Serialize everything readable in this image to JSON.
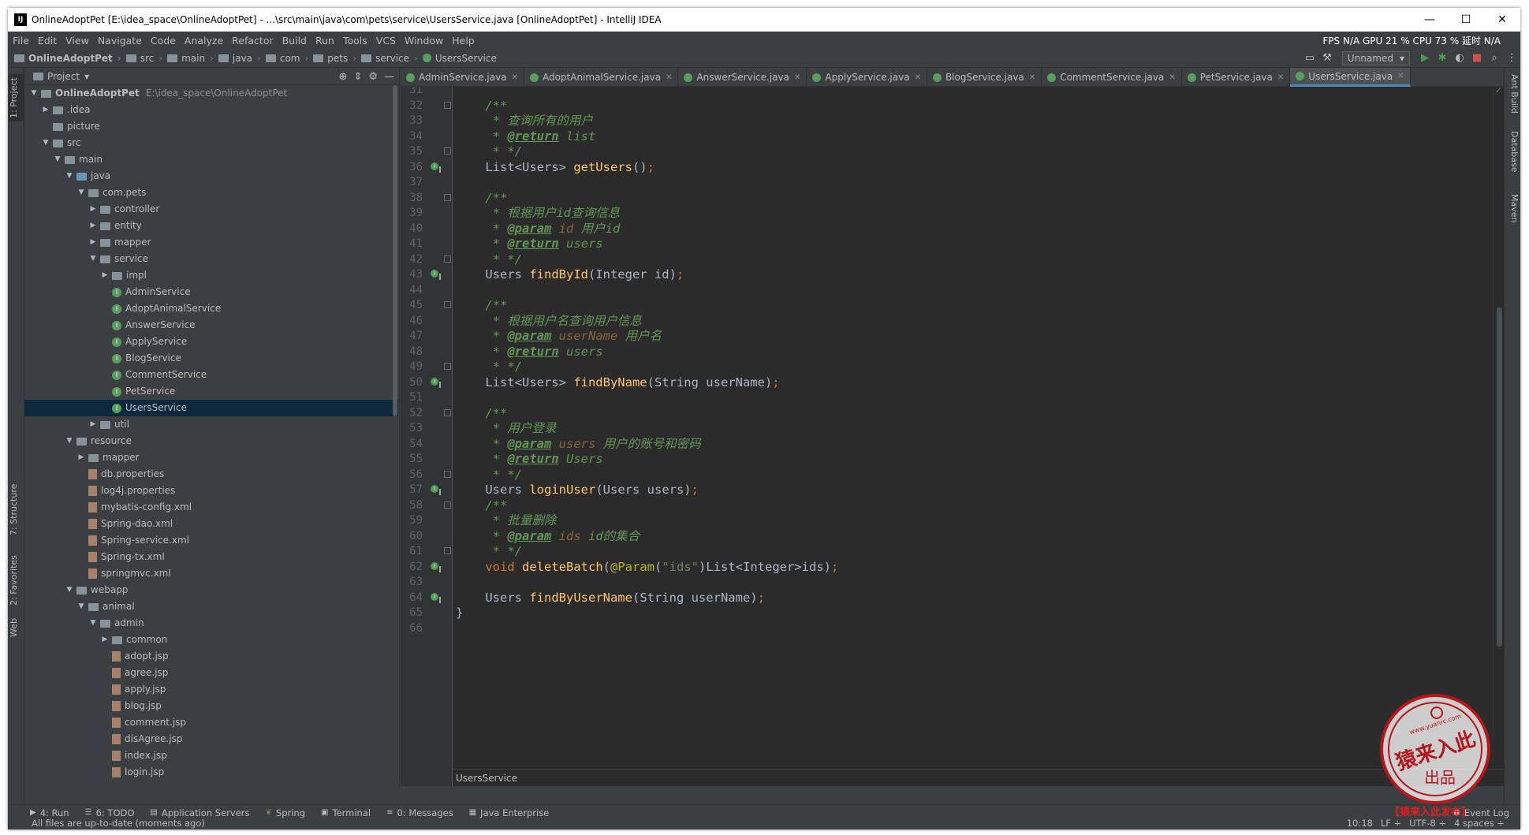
{
  "window": {
    "title": "OnlineAdoptPet [E:\\idea_space\\OnlineAdoptPet] - ...\\src\\main\\java\\com\\pets\\service\\UsersService.java [OnlineAdoptPet] - IntelliJ IDEA",
    "app_badge": "IJ",
    "minimize": "—",
    "maximize": "☐",
    "close": "✕"
  },
  "menu": [
    "File",
    "Edit",
    "View",
    "Navigate",
    "Code",
    "Analyze",
    "Refactor",
    "Build",
    "Run",
    "Tools",
    "VCS",
    "Window",
    "Help"
  ],
  "perf": "FPS  N/A  GPU  21 %  CPU  73 %  延时  N/A",
  "breadcrumb": [
    "OnlineAdoptPet",
    "src",
    "main",
    "java",
    "com",
    "pets",
    "service",
    "UsersService"
  ],
  "run_config": "Unnamed",
  "project_panel": {
    "title": "Project"
  },
  "tree": [
    {
      "label": "OnlineAdoptPet",
      "path": "E:\\idea_space\\OnlineAdoptPet",
      "depth": 0,
      "kind": "module",
      "open": true
    },
    {
      "label": ".idea",
      "depth": 1,
      "kind": "folder",
      "open": false
    },
    {
      "label": "picture",
      "depth": 1,
      "kind": "folder",
      "leaf": true
    },
    {
      "label": "src",
      "depth": 1,
      "kind": "folder",
      "open": true
    },
    {
      "label": "main",
      "depth": 2,
      "kind": "folder",
      "open": true
    },
    {
      "label": "java",
      "depth": 3,
      "kind": "src",
      "open": true
    },
    {
      "label": "com.pets",
      "depth": 4,
      "kind": "folder",
      "open": true
    },
    {
      "label": "controller",
      "depth": 5,
      "kind": "folder",
      "open": false
    },
    {
      "label": "entity",
      "depth": 5,
      "kind": "folder",
      "open": false
    },
    {
      "label": "mapper",
      "depth": 5,
      "kind": "folder",
      "open": false
    },
    {
      "label": "service",
      "depth": 5,
      "kind": "folder",
      "open": true
    },
    {
      "label": "impl",
      "depth": 6,
      "kind": "folder",
      "open": false
    },
    {
      "label": "AdminService",
      "depth": 6,
      "kind": "interface"
    },
    {
      "label": "AdoptAnimalService",
      "depth": 6,
      "kind": "interface"
    },
    {
      "label": "AnswerService",
      "depth": 6,
      "kind": "interface"
    },
    {
      "label": "ApplyService",
      "depth": 6,
      "kind": "interface"
    },
    {
      "label": "BlogService",
      "depth": 6,
      "kind": "interface"
    },
    {
      "label": "CommentService",
      "depth": 6,
      "kind": "interface"
    },
    {
      "label": "PetService",
      "depth": 6,
      "kind": "interface"
    },
    {
      "label": "UsersService",
      "depth": 6,
      "kind": "interface",
      "selected": true
    },
    {
      "label": "util",
      "depth": 5,
      "kind": "folder",
      "open": false
    },
    {
      "label": "resource",
      "depth": 3,
      "kind": "folder",
      "open": true
    },
    {
      "label": "mapper",
      "depth": 4,
      "kind": "folder",
      "open": false
    },
    {
      "label": "db.properties",
      "depth": 4,
      "kind": "file"
    },
    {
      "label": "log4j.properties",
      "depth": 4,
      "kind": "file"
    },
    {
      "label": "mybatis-config.xml",
      "depth": 4,
      "kind": "file"
    },
    {
      "label": "Spring-dao.xml",
      "depth": 4,
      "kind": "file"
    },
    {
      "label": "Spring-service.xml",
      "depth": 4,
      "kind": "file"
    },
    {
      "label": "Spring-tx.xml",
      "depth": 4,
      "kind": "file"
    },
    {
      "label": "springmvc.xml",
      "depth": 4,
      "kind": "file"
    },
    {
      "label": "webapp",
      "depth": 3,
      "kind": "folder",
      "open": true
    },
    {
      "label": "animal",
      "depth": 4,
      "kind": "folder",
      "open": true
    },
    {
      "label": "admin",
      "depth": 5,
      "kind": "folder",
      "open": true
    },
    {
      "label": "common",
      "depth": 6,
      "kind": "folder",
      "open": false
    },
    {
      "label": "adopt.jsp",
      "depth": 6,
      "kind": "file"
    },
    {
      "label": "agree.jsp",
      "depth": 6,
      "kind": "file"
    },
    {
      "label": "apply.jsp",
      "depth": 6,
      "kind": "file"
    },
    {
      "label": "blog.jsp",
      "depth": 6,
      "kind": "file"
    },
    {
      "label": "comment.jsp",
      "depth": 6,
      "kind": "file"
    },
    {
      "label": "disAgree.jsp",
      "depth": 6,
      "kind": "file"
    },
    {
      "label": "index.jsp",
      "depth": 6,
      "kind": "file"
    },
    {
      "label": "login.jsp",
      "depth": 6,
      "kind": "file"
    }
  ],
  "tabs": [
    {
      "label": "AdminService.java"
    },
    {
      "label": "AdoptAnimalService.java"
    },
    {
      "label": "AnswerService.java"
    },
    {
      "label": "ApplyService.java"
    },
    {
      "label": "BlogService.java"
    },
    {
      "label": "CommentService.java"
    },
    {
      "label": "PetService.java"
    },
    {
      "label": "UsersService.java",
      "active": true
    }
  ],
  "code_lines": [
    {
      "n": "31",
      "fold": false,
      "impl": false,
      "segs": []
    },
    {
      "n": "32",
      "fold": true,
      "impl": false,
      "segs": [
        [
          "cm",
          "    /**"
        ]
      ]
    },
    {
      "n": "33",
      "fold": false,
      "impl": false,
      "segs": [
        [
          "cm",
          "     * 查询所有的用户"
        ]
      ]
    },
    {
      "n": "34",
      "fold": false,
      "impl": false,
      "segs": [
        [
          "cm",
          "     * "
        ],
        [
          "tag",
          "@return"
        ],
        [
          "cm",
          " list"
        ]
      ]
    },
    {
      "n": "35",
      "fold": true,
      "impl": false,
      "segs": [
        [
          "cm",
          "     * */"
        ]
      ]
    },
    {
      "n": "36",
      "fold": false,
      "impl": true,
      "segs": [
        [
          "p",
          "    List<Users> "
        ],
        [
          "fn",
          "getUsers"
        ],
        [
          "p",
          "()"
        ],
        [
          "kw",
          ";"
        ]
      ]
    },
    {
      "n": "37",
      "fold": false,
      "impl": false,
      "segs": []
    },
    {
      "n": "38",
      "fold": true,
      "impl": false,
      "segs": [
        [
          "cm",
          "    /**"
        ]
      ]
    },
    {
      "n": "39",
      "fold": false,
      "impl": false,
      "segs": [
        [
          "cm",
          "     * 根据用户id查询信息"
        ]
      ]
    },
    {
      "n": "40",
      "fold": false,
      "impl": false,
      "segs": [
        [
          "cm",
          "     * "
        ],
        [
          "tag",
          "@param"
        ],
        [
          "pn",
          " id"
        ],
        [
          "cm",
          " 用户id"
        ]
      ]
    },
    {
      "n": "41",
      "fold": false,
      "impl": false,
      "segs": [
        [
          "cm",
          "     * "
        ],
        [
          "tag",
          "@return"
        ],
        [
          "cm",
          " users"
        ]
      ]
    },
    {
      "n": "42",
      "fold": true,
      "impl": false,
      "segs": [
        [
          "cm",
          "     * */"
        ]
      ]
    },
    {
      "n": "43",
      "fold": false,
      "impl": true,
      "segs": [
        [
          "p",
          "    Users "
        ],
        [
          "fn",
          "findById"
        ],
        [
          "p",
          "(Integer id)"
        ],
        [
          "kw",
          ";"
        ]
      ]
    },
    {
      "n": "44",
      "fold": false,
      "impl": false,
      "segs": []
    },
    {
      "n": "45",
      "fold": true,
      "impl": false,
      "segs": [
        [
          "cm",
          "    /**"
        ]
      ]
    },
    {
      "n": "46",
      "fold": false,
      "impl": false,
      "segs": [
        [
          "cm",
          "     * 根据用户名查询用户信息"
        ]
      ]
    },
    {
      "n": "47",
      "fold": false,
      "impl": false,
      "segs": [
        [
          "cm",
          "     * "
        ],
        [
          "tag",
          "@param"
        ],
        [
          "pn",
          " userName"
        ],
        [
          "cm",
          " 用户名"
        ]
      ]
    },
    {
      "n": "48",
      "fold": false,
      "impl": false,
      "segs": [
        [
          "cm",
          "     * "
        ],
        [
          "tag",
          "@return"
        ],
        [
          "cm",
          " users"
        ]
      ]
    },
    {
      "n": "49",
      "fold": true,
      "impl": false,
      "segs": [
        [
          "cm",
          "     * */"
        ]
      ]
    },
    {
      "n": "50",
      "fold": false,
      "impl": true,
      "segs": [
        [
          "p",
          "    List<Users> "
        ],
        [
          "fn",
          "findByName"
        ],
        [
          "p",
          "(String userName)"
        ],
        [
          "kw",
          ";"
        ]
      ]
    },
    {
      "n": "51",
      "fold": false,
      "impl": false,
      "segs": []
    },
    {
      "n": "52",
      "fold": true,
      "impl": false,
      "segs": [
        [
          "cm",
          "    /**"
        ]
      ]
    },
    {
      "n": "53",
      "fold": false,
      "impl": false,
      "segs": [
        [
          "cm",
          "     * 用户登录"
        ]
      ]
    },
    {
      "n": "54",
      "fold": false,
      "impl": false,
      "segs": [
        [
          "cm",
          "     * "
        ],
        [
          "tag",
          "@param"
        ],
        [
          "pn",
          " users"
        ],
        [
          "cm",
          " 用户的账号和密码"
        ]
      ]
    },
    {
      "n": "55",
      "fold": false,
      "impl": false,
      "segs": [
        [
          "cm",
          "     * "
        ],
        [
          "tag",
          "@return"
        ],
        [
          "cm",
          " Users"
        ]
      ]
    },
    {
      "n": "56",
      "fold": true,
      "impl": false,
      "segs": [
        [
          "cm",
          "     * */"
        ]
      ]
    },
    {
      "n": "57",
      "fold": false,
      "impl": true,
      "segs": [
        [
          "p",
          "    Users "
        ],
        [
          "fn",
          "loginUser"
        ],
        [
          "p",
          "(Users users)"
        ],
        [
          "kw",
          ";"
        ]
      ]
    },
    {
      "n": "58",
      "fold": true,
      "impl": false,
      "segs": [
        [
          "cm",
          "    /**"
        ]
      ]
    },
    {
      "n": "59",
      "fold": false,
      "impl": false,
      "segs": [
        [
          "cm",
          "     * 批量删除"
        ]
      ]
    },
    {
      "n": "60",
      "fold": false,
      "impl": false,
      "segs": [
        [
          "cm",
          "     * "
        ],
        [
          "tag",
          "@param"
        ],
        [
          "pn",
          " ids"
        ],
        [
          "cm",
          " id的集合"
        ]
      ]
    },
    {
      "n": "61",
      "fold": true,
      "impl": false,
      "segs": [
        [
          "cm",
          "     * */"
        ]
      ]
    },
    {
      "n": "62",
      "fold": false,
      "impl": true,
      "segs": [
        [
          "kw",
          "    void "
        ],
        [
          "fn",
          "deleteBatch"
        ],
        [
          "p",
          "("
        ],
        [
          "an",
          "@Param"
        ],
        [
          "p",
          "("
        ],
        [
          "st",
          "\"ids\""
        ],
        [
          "p",
          ")List<Integer>ids)"
        ],
        [
          "kw",
          ";"
        ]
      ]
    },
    {
      "n": "63",
      "fold": false,
      "impl": false,
      "segs": []
    },
    {
      "n": "64",
      "fold": false,
      "impl": true,
      "segs": [
        [
          "p",
          "    Users "
        ],
        [
          "fn",
          "findByUserName"
        ],
        [
          "p",
          "(String userName)"
        ],
        [
          "kw",
          ";"
        ]
      ]
    },
    {
      "n": "65",
      "fold": false,
      "impl": false,
      "segs": [
        [
          "p",
          "}"
        ]
      ]
    },
    {
      "n": "66",
      "fold": false,
      "impl": false,
      "segs": []
    }
  ],
  "editor_breadcrumb": "UsersService",
  "left_tool_tabs": [
    "1: Project",
    "7: Structure",
    "2: Favorites",
    "Web"
  ],
  "right_tool_tabs": [
    "Ant Build",
    "Database",
    "Maven"
  ],
  "bottom_tabs": [
    "4: Run",
    "6: TODO",
    "Application Servers",
    "Spring",
    "Terminal",
    "0: Messages",
    "Java Enterprise"
  ],
  "event_log": "Event Log",
  "status": {
    "message": "All files are up-to-date (moments ago)",
    "position": "10:18",
    "line_sep": "LF ÷",
    "encoding": "UTF-8 ÷",
    "indent": "4 spaces ÷"
  },
  "watermark": {
    "url": "www.yuanrc.com",
    "line1": "猿来入此",
    "line2": "出品",
    "banner": "【猿来入此发布】",
    "color": "#c4141a"
  }
}
